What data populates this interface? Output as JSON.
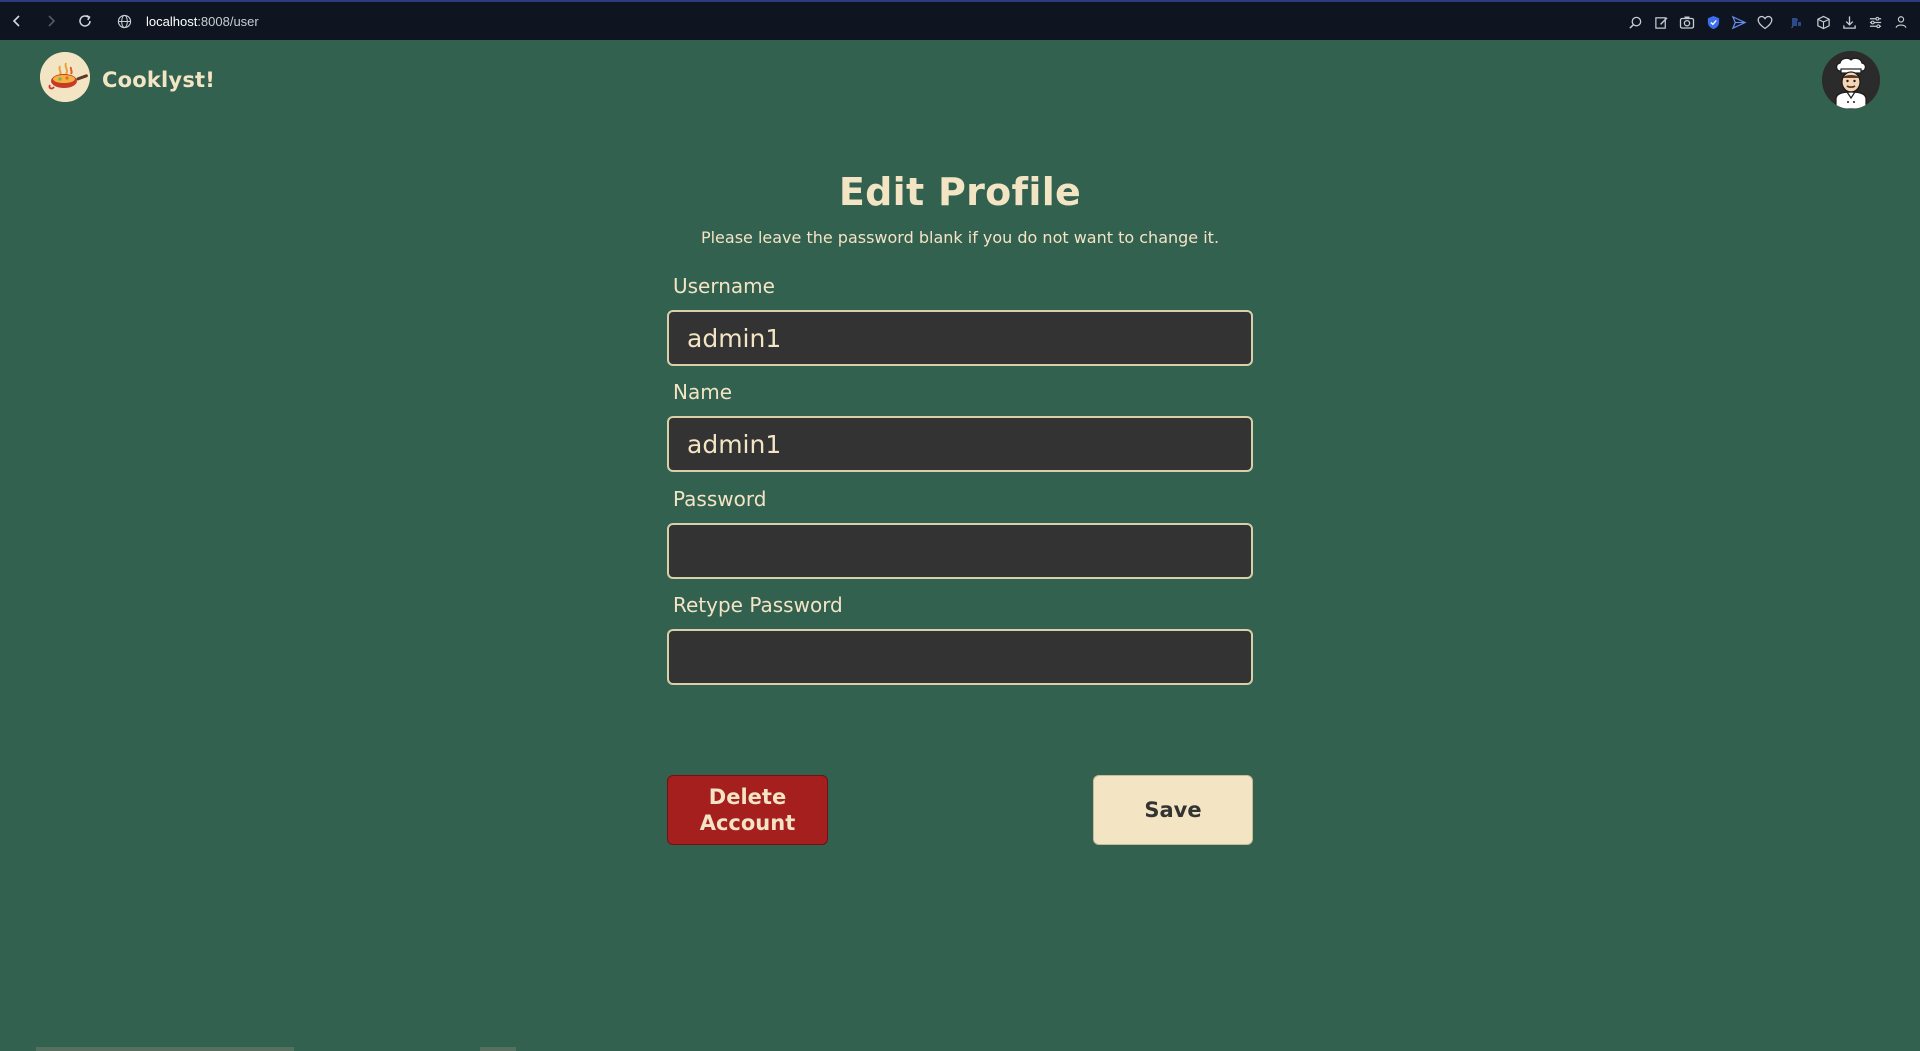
{
  "browser": {
    "url_host": "localhost",
    "url_path": ":8008/user",
    "icons": [
      "back-icon",
      "forward-icon",
      "reload-icon",
      "globe-icon",
      "zoom-icon",
      "edit-icon",
      "camera-icon",
      "shield-icon",
      "send-icon",
      "heart-icon",
      "extension-icon",
      "cube-icon",
      "download-icon",
      "menu-icon",
      "account-icon"
    ]
  },
  "header": {
    "brand": "Cooklyst!",
    "logo_icon": "cooking-pan-icon",
    "avatar_icon": "chef-avatar-icon"
  },
  "form": {
    "title": "Edit Profile",
    "subtitle": "Please leave the password blank if you do not want to change it.",
    "username_label": "Username",
    "username_value": "admin1",
    "name_label": "Name",
    "name_value": "admin1",
    "password_label": "Password",
    "password_value": "",
    "retype_label": "Retype Password",
    "retype_value": "",
    "delete_label": "Delete Account",
    "save_label": "Save"
  },
  "colors": {
    "background": "#336150",
    "cream": "#f3e4c4",
    "input_bg": "#333333",
    "danger": "#a51f1f"
  }
}
